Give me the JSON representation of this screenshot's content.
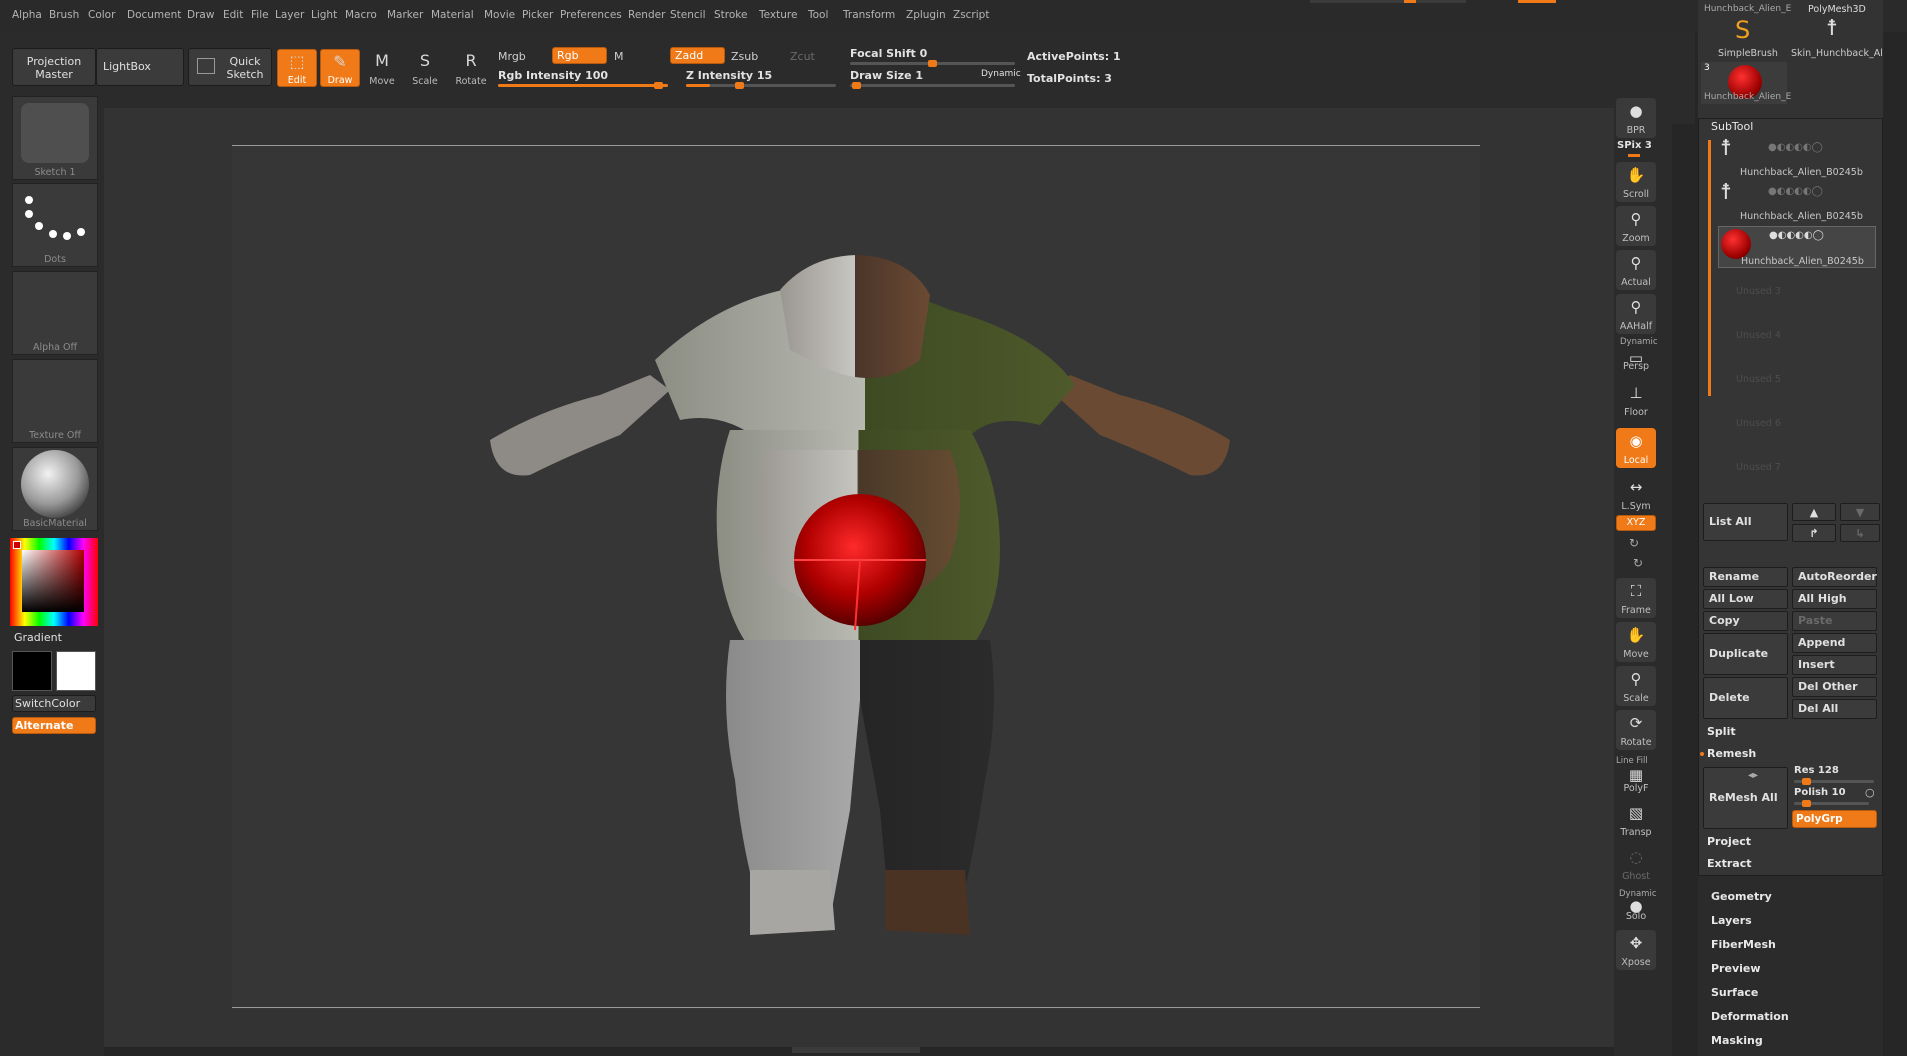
{
  "menu": [
    "Alpha",
    "Brush",
    "Color",
    "Document",
    "Draw",
    "Edit",
    "File",
    "Layer",
    "Light",
    "Macro",
    "Marker",
    "Material",
    "Movie",
    "Picker",
    "Preferences",
    "Render",
    "Stencil",
    "Stroke",
    "Texture",
    "Tool",
    "Transform",
    "Zplugin",
    "Zscript"
  ],
  "toolbar": {
    "projection_master": "Projection Master",
    "lightbox": "LightBox",
    "quick_sketch": "Quick Sketch",
    "edit": "Edit",
    "draw": "Draw",
    "move": "Move",
    "scale": "Scale",
    "rotate": "Rotate",
    "mrgb": "Mrgb",
    "rgb": "Rgb",
    "m": "M",
    "zadd": "Zadd",
    "zsub": "Zsub",
    "zcut": "Zcut",
    "rgb_intensity": "Rgb Intensity 100",
    "z_intensity": "Z Intensity 15",
    "focal_shift": "Focal Shift 0",
    "draw_size": "Draw Size 1",
    "dynamic": "Dynamic",
    "active_points": "ActivePoints: 1",
    "total_points": "TotalPoints: 3",
    "rgb_intensity_value": 100,
    "z_intensity_value": 15
  },
  "left": {
    "sketch": "Sketch 1",
    "dots": "Dots",
    "alpha": "Alpha Off",
    "texture": "Texture Off",
    "material": "BasicMaterial",
    "gradient": "Gradient",
    "switchcolor": "SwitchColor",
    "alternate": "Alternate"
  },
  "right": {
    "bpr": "BPR",
    "spix": "SPix 3",
    "scroll": "Scroll",
    "zoom": "Zoom",
    "actual": "Actual",
    "aahalf": "AAHalf",
    "dynamic": "Dynamic",
    "persp": "Persp",
    "floor": "Floor",
    "local": "Local",
    "lsym": "L.Sym",
    "xyz": "XYZ",
    "frame": "Frame",
    "move": "Move",
    "scale": "Scale",
    "rotate": "Rotate",
    "linefill": "Line Fill",
    "polyf": "PolyF",
    "transp": "Transp",
    "ghost": "Ghost",
    "dynamic2": "Dynamic",
    "solo": "Solo",
    "xpose": "Xpose"
  },
  "tool_panel": {
    "thumb1": "Hunchback_Alien_E",
    "thumb2": "PolyMesh3D",
    "thumb3": "SimpleBrush",
    "thumb4": "Skin_Hunchback_Al",
    "thumb5": "Hunchback_Alien_E",
    "thumb5_count": "3",
    "subtool_header": "SubTool",
    "subtools": [
      "Hunchback_Alien_B0245b",
      "Hunchback_Alien_B0245b",
      "Hunchback_Alien_B0245b"
    ],
    "unused": [
      "Unused 3",
      "Unused 4",
      "Unused 5",
      "Unused 6",
      "Unused 7"
    ],
    "list_all": "List All",
    "rename": "Rename",
    "autoreorder": "AutoReorder",
    "all_low": "All Low",
    "all_high": "All High",
    "copy": "Copy",
    "paste": "Paste",
    "duplicate": "Duplicate",
    "append": "Append",
    "insert": "Insert",
    "delete": "Delete",
    "del_other": "Del Other",
    "del_all": "Del All",
    "split": "Split",
    "remesh": "Remesh",
    "remesh_all": "ReMesh All",
    "res": "Res 128",
    "polish": "Polish 10",
    "polygrp": "PolyGrp",
    "project": "Project",
    "extract": "Extract",
    "sections": [
      "Geometry",
      "Layers",
      "FiberMesh",
      "Preview",
      "Surface",
      "Deformation",
      "Masking"
    ]
  },
  "colors": {
    "accent": "#f07a17",
    "panel": "#2b2b2b",
    "canvas": "#363636"
  }
}
